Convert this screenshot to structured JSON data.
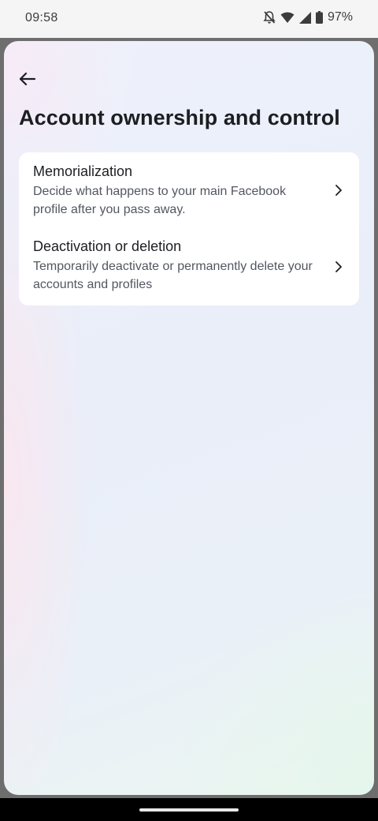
{
  "status_bar": {
    "time": "09:58",
    "battery": "97%",
    "icons": [
      "notifications-off-icon",
      "wifi-icon",
      "signal-icon",
      "battery-icon"
    ]
  },
  "header": {
    "back_icon": "arrow-left-icon",
    "title": "Account ownership and control"
  },
  "menu": {
    "items": [
      {
        "title": "Memorialization",
        "description": "Decide what happens to your main Facebook profile after you pass away.",
        "icon": "chevron-right-icon"
      },
      {
        "title": "Deactivation or deletion",
        "description": "Temporarily deactivate or permanently delete your accounts and profiles",
        "icon": "chevron-right-icon"
      }
    ]
  },
  "colors": {
    "text_primary": "#1c1e21",
    "text_secondary": "#525760",
    "card_background": "#ffffff",
    "sheet_tint": "#e9eef9"
  }
}
